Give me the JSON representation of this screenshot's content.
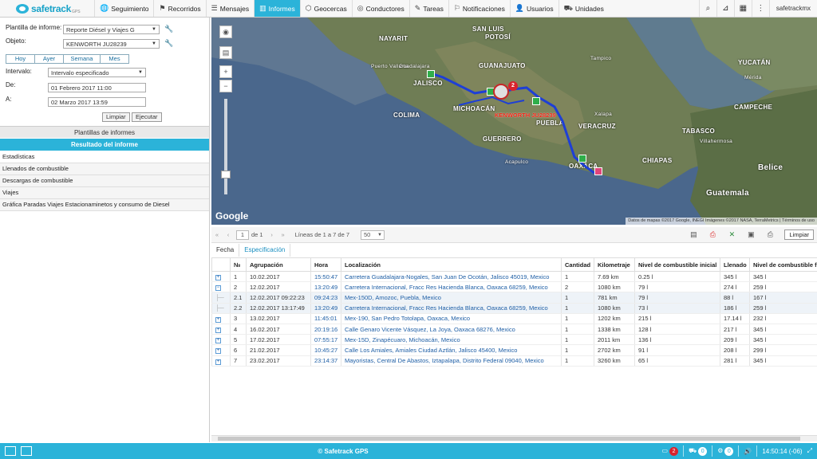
{
  "app": {
    "logo_text": "safetrack",
    "logo_sub": "GPS"
  },
  "nav": [
    {
      "label": "Seguimiento",
      "icon": "🌐"
    },
    {
      "label": "Recorridos",
      "icon": "⚑"
    },
    {
      "label": "Mensajes",
      "icon": "☰"
    },
    {
      "label": "Informes",
      "icon": "▥"
    },
    {
      "label": "Geocercas",
      "icon": "⬡"
    },
    {
      "label": "Conductores",
      "icon": "◎"
    },
    {
      "label": "Tareas",
      "icon": "✎"
    },
    {
      "label": "Notificaciones",
      "icon": "⚐"
    },
    {
      "label": "Usuarios",
      "icon": "👤"
    },
    {
      "label": "Unidades",
      "icon": "⛟"
    }
  ],
  "topright": {
    "user": "safetrackmx"
  },
  "form": {
    "template_label": "Plantilla de informe:",
    "template_value": "Reporte Diésel y Viajes G",
    "object_label": "Objeto:",
    "object_value": "KENWORTH JU28239",
    "periods": [
      "Hoy",
      "Ayer",
      "Semana",
      "Mes"
    ],
    "interval_label": "Intervalo:",
    "interval_value": "Intervalo especificado",
    "from_label": "De:",
    "from_value": "01 Febrero 2017 11:00",
    "to_label": "A:",
    "to_value": "02 Marzo 2017 13:59",
    "clear_label": "Limpiar",
    "run_label": "Ejecutar"
  },
  "sections": {
    "templates": "Plantillas de informes",
    "result": "Resultado del informe"
  },
  "result_items": [
    "Estadísticas",
    "Llenados de combustible",
    "Descargas de combustible",
    "Viajes",
    "Gráfica Paradas Viajes Estacionaminetos y consumo de Diesel"
  ],
  "map": {
    "labels": [
      {
        "text": "NAYARIT",
        "cls": ""
      },
      {
        "text": "SAN LUIS",
        "cls": ""
      },
      {
        "text": "POTOSÍ",
        "cls": ""
      },
      {
        "text": "GUANAJUATO",
        "cls": ""
      },
      {
        "text": "JALISCO",
        "cls": ""
      },
      {
        "text": "MICHOACÁN",
        "cls": ""
      },
      {
        "text": "COLIMA",
        "cls": ""
      },
      {
        "text": "PUEBLA",
        "cls": ""
      },
      {
        "text": "GUERRERO",
        "cls": ""
      },
      {
        "text": "VERACRUZ",
        "cls": ""
      },
      {
        "text": "OAXACA",
        "cls": ""
      },
      {
        "text": "TABASCO",
        "cls": ""
      },
      {
        "text": "CHIAPAS",
        "cls": ""
      },
      {
        "text": "CAMPECHE",
        "cls": ""
      },
      {
        "text": "YUCATÁN",
        "cls": ""
      },
      {
        "text": "Belice",
        "cls": "big"
      },
      {
        "text": "Guatemala",
        "cls": "big"
      },
      {
        "text": "Mérida",
        "cls": "city"
      },
      {
        "text": "Puerto Vallarta",
        "cls": "city"
      },
      {
        "text": "Guadalajara",
        "cls": "city"
      },
      {
        "text": "Acapulco",
        "cls": "city"
      },
      {
        "text": "Villahermosa",
        "cls": "city"
      },
      {
        "text": "Tampico",
        "cls": "city"
      },
      {
        "text": "Xalapa",
        "cls": "city"
      }
    ],
    "unit_label": "KENWORTH JU28239",
    "cluster_count": "2",
    "google": "Google",
    "attribution": "Datos de mapas ©2017 Google, INEGI Imágenes ©2017 NASA, TerraMetrics | Términos de uso"
  },
  "report_toolbar": {
    "page": "1",
    "of_label": "de 1",
    "rows_label": "Líneas de 1 a 7 de 7",
    "per_page": "50",
    "clear_label": "Limpiar"
  },
  "tabs": [
    "Fecha",
    "Especificación"
  ],
  "table": {
    "columns": [
      "№",
      "Agrupación",
      "Hora",
      "Localización",
      "Cantidad",
      "Kilometraje",
      "Nivel de combustible inicial",
      "Llenado",
      "Nivel de combustible final"
    ],
    "rows": [
      {
        "exp": "+",
        "n": "1",
        "grp": "10.02.2017",
        "hora": "15:50:47",
        "loc": "Carretera Guadalajara-Nogales, San Juan De Ocotán, Jalisco 45019, Mexico",
        "cant": "1",
        "km": "7.69 km",
        "ini": "0.25 l",
        "llen": "345 l",
        "fin": "345 l"
      },
      {
        "exp": "−",
        "n": "2",
        "grp": "12.02.2017",
        "hora": "13:20:49",
        "loc": "Carretera Internacional, Fracc Res Hacienda Blanca, Oaxaca 68259, Mexico",
        "cant": "2",
        "km": "1080 km",
        "ini": "79 l",
        "llen": "274 l",
        "fin": "259 l"
      },
      {
        "exp": "",
        "n": "2.1",
        "grp": "12.02.2017 09:22:23",
        "hora": "09:24:23",
        "loc": "Mex-150D, Amozoc, Puebla, Mexico",
        "cant": "1",
        "km": "781 km",
        "ini": "79 l",
        "llen": "88 l",
        "fin": "167 l",
        "sub": true
      },
      {
        "exp": "",
        "n": "2.2",
        "grp": "12.02.2017 13:17:49",
        "hora": "13:20:49",
        "loc": "Carretera Internacional, Fracc Res Hacienda Blanca, Oaxaca 68259, Mexico",
        "cant": "1",
        "km": "1080 km",
        "ini": "73 l",
        "llen": "186 l",
        "fin": "259 l",
        "sub": true
      },
      {
        "exp": "+",
        "n": "3",
        "grp": "13.02.2017",
        "hora": "11:45:01",
        "loc": "Mex-190, San Pedro Totolapa, Oaxaca, Mexico",
        "cant": "1",
        "km": "1202 km",
        "ini": "215 l",
        "llen": "17.14 l",
        "fin": "232 l"
      },
      {
        "exp": "+",
        "n": "4",
        "grp": "16.02.2017",
        "hora": "20:19:16",
        "loc": "Calle Genaro Vicente Vásquez, La Joya, Oaxaca 68276, Mexico",
        "cant": "1",
        "km": "1338 km",
        "ini": "128 l",
        "llen": "217 l",
        "fin": "345 l"
      },
      {
        "exp": "+",
        "n": "5",
        "grp": "17.02.2017",
        "hora": "07:55:17",
        "loc": "Mex-15D, Zinapécuaro, Michoacán, Mexico",
        "cant": "1",
        "km": "2011 km",
        "ini": "136 l",
        "llen": "209 l",
        "fin": "345 l"
      },
      {
        "exp": "+",
        "n": "6",
        "grp": "21.02.2017",
        "hora": "10:45:27",
        "loc": "Calle Los Amiales, Amiales Ciudad Aztlán, Jalisco 45400, Mexico",
        "cant": "1",
        "km": "2702 km",
        "ini": "91 l",
        "llen": "208 l",
        "fin": "299 l"
      },
      {
        "exp": "+",
        "n": "7",
        "grp": "23.02.2017",
        "hora": "23:14:37",
        "loc": "Mayoristas, Central De Abastos, Iztapalapa, Distrito Federal 09040, Mexico",
        "cant": "1",
        "km": "3260 km",
        "ini": "65 l",
        "llen": "281 l",
        "fin": "345 l"
      }
    ]
  },
  "bottom": {
    "center": "© Safetrack GPS",
    "counts": [
      "2",
      "0",
      "0"
    ],
    "time": "14:50:14 (-06)"
  },
  "colors": {
    "accent": "#2bb3d9",
    "route": "#1e3fd6",
    "alert": "#d9232d"
  }
}
